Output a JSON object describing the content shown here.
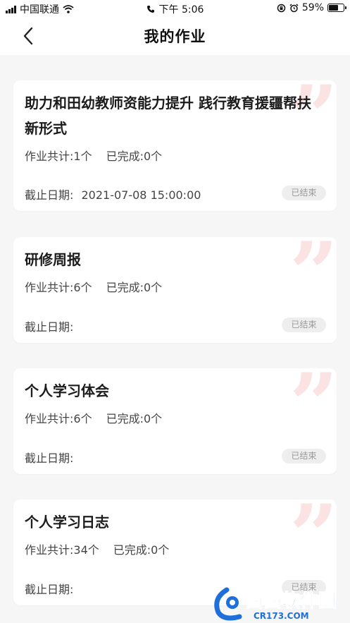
{
  "status_bar": {
    "carrier": "中国联通",
    "time": "下午 5:06",
    "battery": "59%"
  },
  "nav": {
    "title": "我的作业"
  },
  "assignments": [
    {
      "title": "助力和田幼教师资能力提升 践行教育援疆帮扶新形式",
      "total": "作业共计:1个",
      "done": "已完成:0个",
      "deadline_label": "截止日期:",
      "deadline_value": "2021-07-08 15:00:00",
      "status": "已结束"
    },
    {
      "title": "研修周报",
      "total": "作业共计:6个",
      "done": "已完成:0个",
      "deadline_label": "截止日期:",
      "deadline_value": "",
      "status": "已结束"
    },
    {
      "title": "个人学习体会",
      "total": "作业共计:6个",
      "done": "已完成:0个",
      "deadline_label": "截止日期:",
      "deadline_value": "",
      "status": "已结束"
    },
    {
      "title": "个人学习日志",
      "total": "作业共计:34个",
      "done": "已完成:0个",
      "deadline_label": "截止日期:",
      "deadline_value": "",
      "status": "已结束"
    }
  ],
  "watermark": {
    "brand": "西西软件园",
    "url": "CR173.COM"
  },
  "colors": {
    "accent_quote": "#fbe3e3",
    "tag_bg": "#eeeeee",
    "watermark_blue": "#1e6fd9"
  }
}
